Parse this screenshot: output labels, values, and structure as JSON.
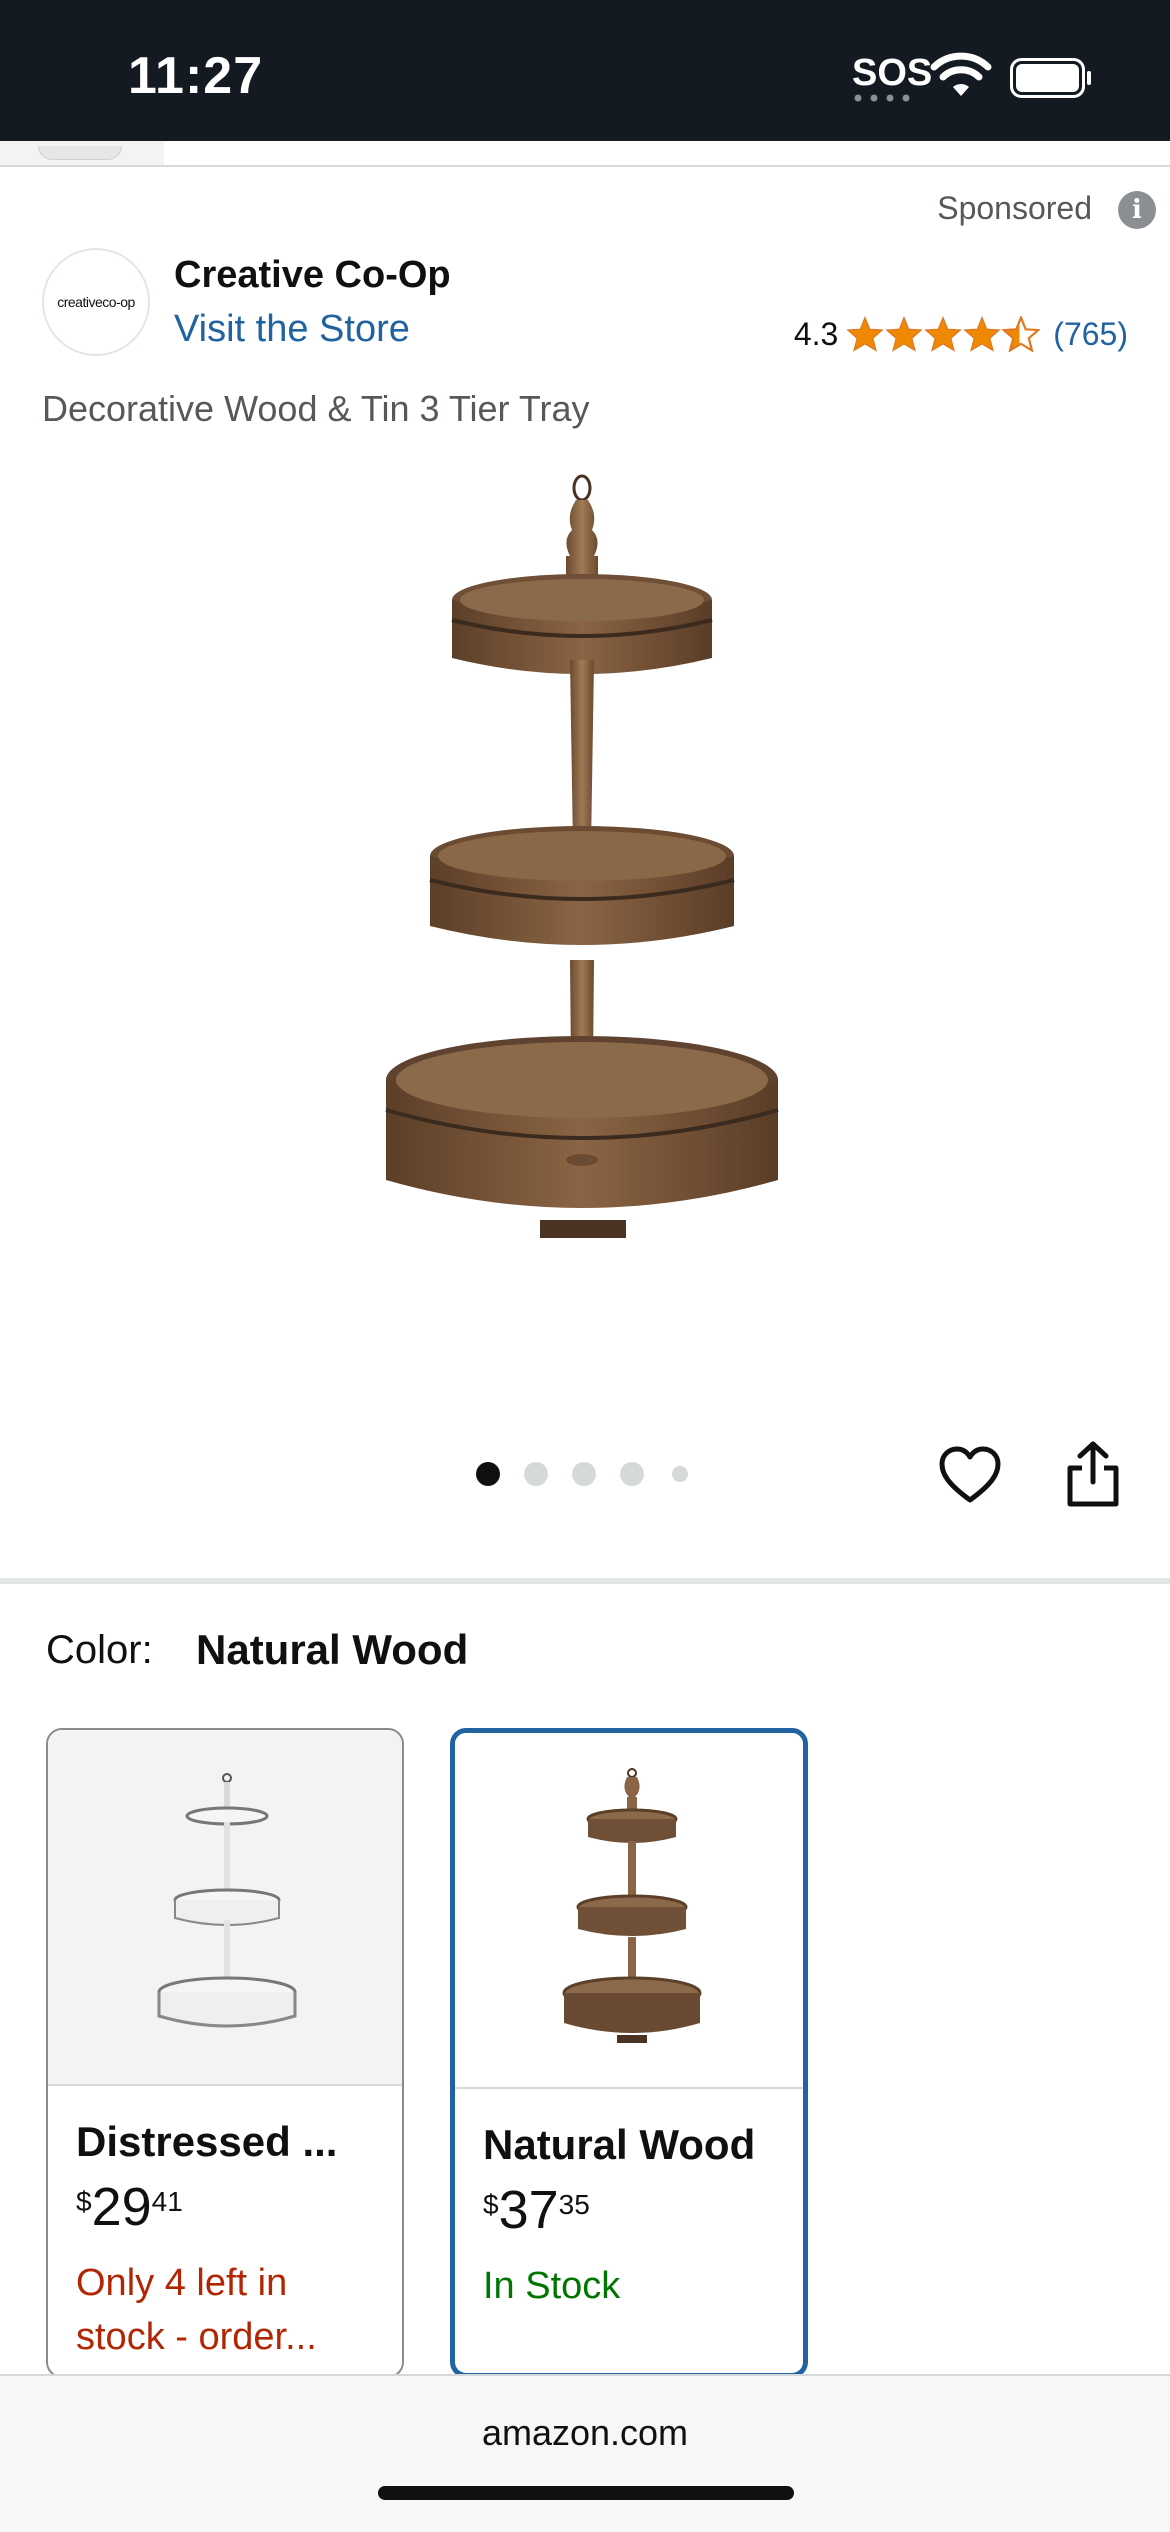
{
  "status_bar": {
    "time": "11:27",
    "sos": "SOS"
  },
  "sponsored": {
    "label": "Sponsored",
    "info_glyph": "i"
  },
  "brand": {
    "logo_text": "creativeco-op",
    "name": "Creative Co-Op",
    "visit_store": "Visit the Store"
  },
  "rating": {
    "value": "4.3",
    "stars_filled": 4.3,
    "count": "(765)",
    "star_color": "#f08804"
  },
  "product": {
    "title": "Decorative Wood & Tin 3 Tier Tray",
    "image_icon": "three-tier-wood-tray-image"
  },
  "carousel": {
    "total_dots": 5,
    "active_index": 0
  },
  "actions": {
    "wishlist_icon": "heart-icon",
    "share_icon": "share-icon"
  },
  "color_selector": {
    "label": "Color:",
    "selected_value": "Natural Wood",
    "options": [
      {
        "name": "Distressed ...",
        "price_symbol": "$",
        "price_whole": "29",
        "price_fraction": "41",
        "stock": "Only 4 left in stock - order...",
        "stock_status": "low",
        "selected": false
      },
      {
        "name": "Natural Wood",
        "price_symbol": "$",
        "price_whole": "37",
        "price_fraction": "35",
        "stock": "In Stock",
        "stock_status": "in",
        "selected": true
      }
    ]
  },
  "browser": {
    "url": "amazon.com"
  },
  "colors": {
    "link_blue": "#2162a1",
    "status_bar_bg": "#131a22",
    "low_stock_red": "#b12704",
    "in_stock_green": "#007600"
  }
}
